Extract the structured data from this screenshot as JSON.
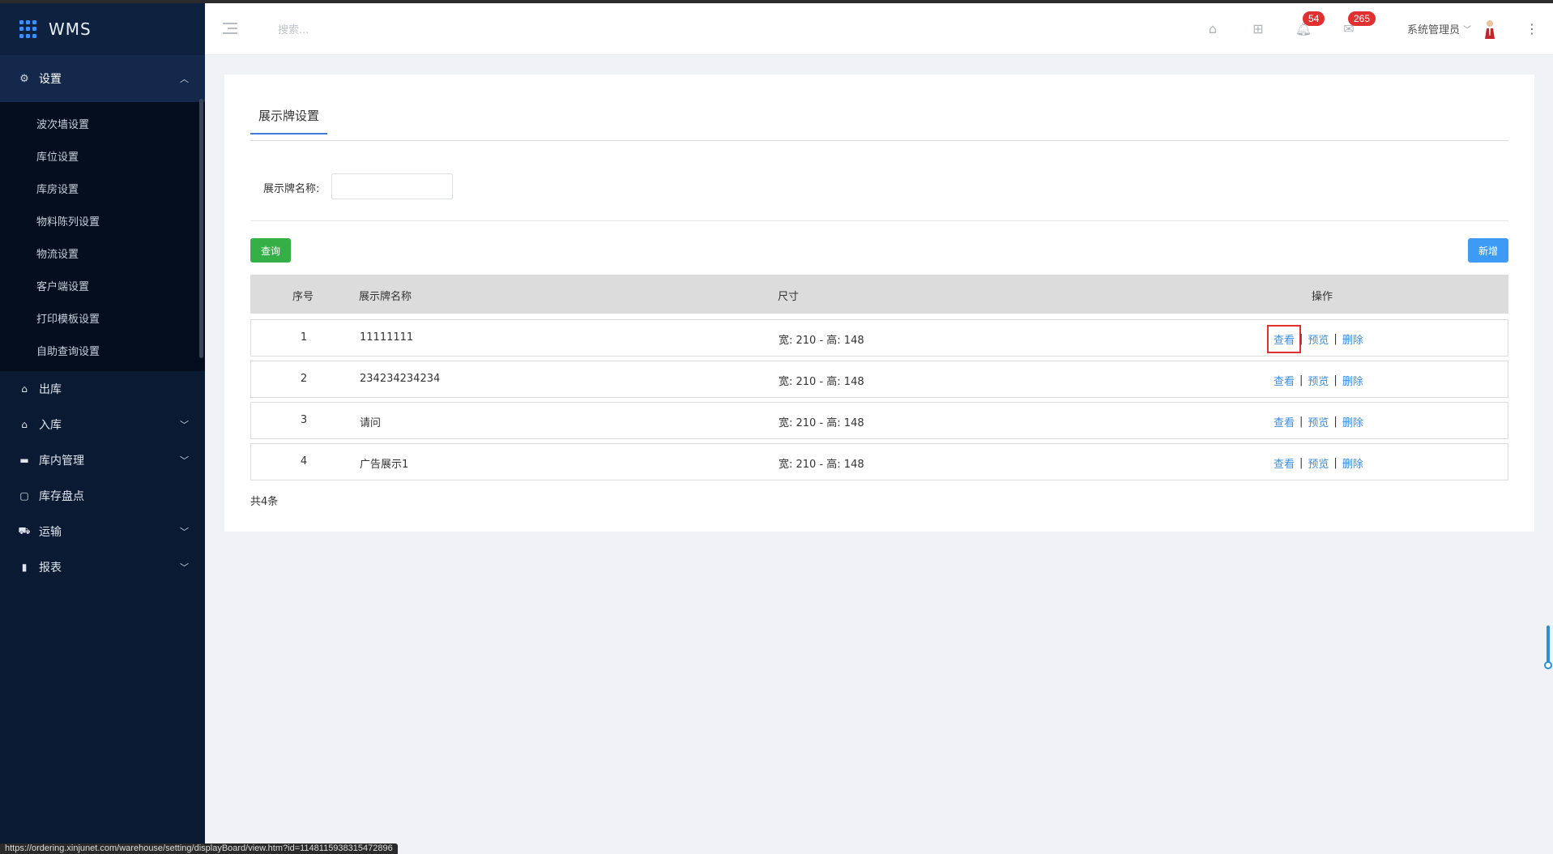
{
  "brand": {
    "title": "WMS"
  },
  "sidebar": {
    "settings_group": {
      "label": "设置",
      "items": [
        "波次墙设置",
        "库位设置",
        "库房设置",
        "物料陈列设置",
        "物流设置",
        "客户端设置",
        "打印模板设置",
        "自助查询设置"
      ]
    },
    "menu": [
      {
        "label": "出库",
        "icon": "outbound-icon",
        "expandable": false
      },
      {
        "label": "入库",
        "icon": "inbound-icon",
        "expandable": true
      },
      {
        "label": "库内管理",
        "icon": "warehouse-icon",
        "expandable": true
      },
      {
        "label": "库存盘点",
        "icon": "inventory-icon",
        "expandable": false
      },
      {
        "label": "运输",
        "icon": "truck-icon",
        "expandable": true
      },
      {
        "label": "报表",
        "icon": "report-icon",
        "expandable": true
      }
    ]
  },
  "header": {
    "search_placeholder": "搜索...",
    "notifications_count": "54",
    "messages_count": "265",
    "user_name": "系统管理员"
  },
  "page": {
    "tab_label": "展示牌设置",
    "filter_label": "展示牌名称:",
    "filter_value": "",
    "query_button": "查询",
    "new_button": "新增",
    "table": {
      "headers": {
        "idx": "序号",
        "name": "展示牌名称",
        "size": "尺寸",
        "ops": "操作"
      },
      "rows": [
        {
          "idx": "1",
          "name": "11111111",
          "size": "宽: 210 - 高: 148"
        },
        {
          "idx": "2",
          "name": "234234234234",
          "size": "宽: 210 - 高: 148"
        },
        {
          "idx": "3",
          "name": "请问",
          "size": "宽: 210 - 高: 148"
        },
        {
          "idx": "4",
          "name": "广告展示1",
          "size": "宽: 210 - 高: 148"
        }
      ],
      "actions": {
        "view": "查看",
        "preview": "预览",
        "delete": "删除",
        "separator": "|"
      }
    },
    "total": "共4条"
  },
  "status_url": "https://ordering.xinjunet.com/warehouse/setting/displayBoard/view.htm?id=1148115938315472896"
}
